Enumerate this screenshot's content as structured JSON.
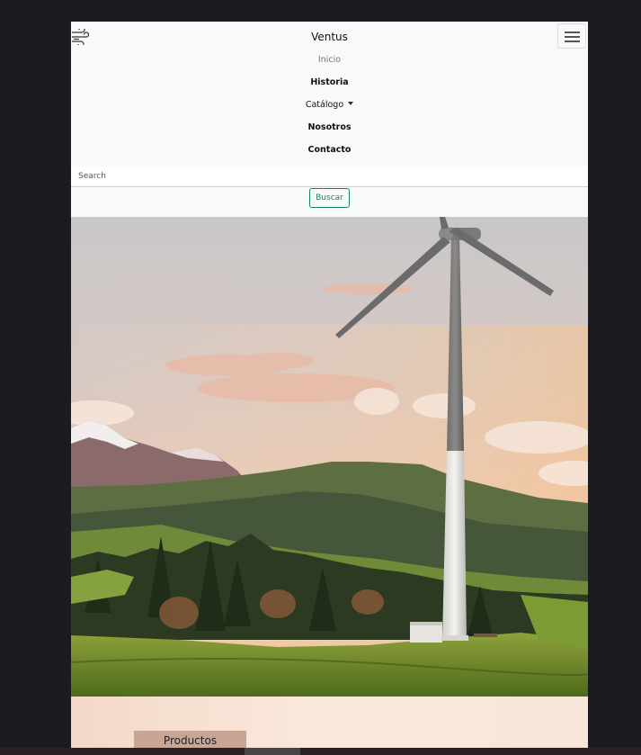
{
  "brand": {
    "name": "Ventus",
    "icon": "wind-icon"
  },
  "navbar": {
    "toggler_icon": "hamburger-icon",
    "items": [
      {
        "label": "Inicio"
      },
      {
        "label": "Historia"
      },
      {
        "label": "Catálogo"
      },
      {
        "label": "Nosotros"
      },
      {
        "label": "Contacto"
      }
    ]
  },
  "search": {
    "placeholder": "Search",
    "button_label": "Buscar"
  },
  "hero": {
    "image": "wind-turbine-landscape"
  },
  "section": {
    "button_label": "Productos"
  },
  "colors": {
    "accent": "#198754",
    "navbar_bg": "#f8f9fa",
    "page_bg": "#1c1b1f"
  }
}
